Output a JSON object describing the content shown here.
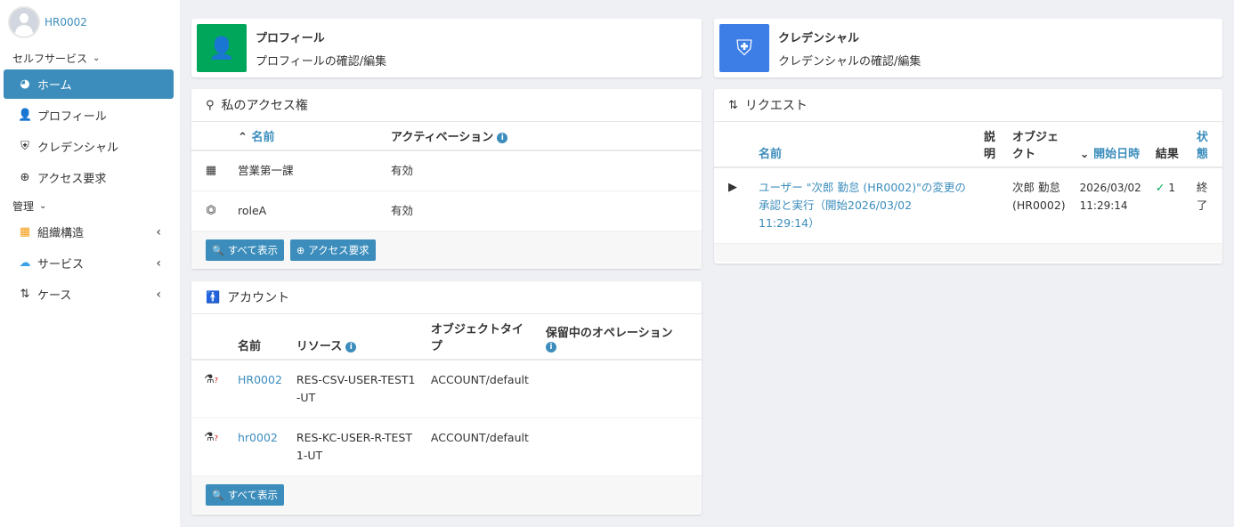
{
  "user": {
    "name": "HR0002"
  },
  "sidebar": {
    "self_service_header": "セルフサービス",
    "admin_header": "管理",
    "items": [
      {
        "label": "ホーム",
        "icon": "dashboard-icon"
      },
      {
        "label": "プロフィール",
        "icon": "user-icon"
      },
      {
        "label": "クレデンシャル",
        "icon": "shield-icon"
      },
      {
        "label": "アクセス要求",
        "icon": "plus-circle-icon"
      }
    ],
    "admin_items": [
      {
        "label": "組織構造",
        "icon": "building-icon"
      },
      {
        "label": "サービス",
        "icon": "cloud-icon"
      },
      {
        "label": "ケース",
        "icon": "sort-arrows-icon"
      }
    ]
  },
  "profile_box": {
    "title": "プロフィール",
    "subtitle": "プロフィールの確認/編集",
    "color": "#00a65a"
  },
  "credential_box": {
    "title": "クレデンシャル",
    "subtitle": "クレデンシャルの確認/編集",
    "color": "#3c7de6"
  },
  "access": {
    "title": "私のアクセス権",
    "columns": {
      "name": "名前",
      "activation": "アクティベーション"
    },
    "rows": [
      {
        "name": "営業第一課",
        "activation": "有効",
        "icon": "building-icon"
      },
      {
        "name": "roleA",
        "activation": "有効",
        "icon": "role-icon"
      }
    ],
    "show_all": "すべて表示",
    "request_access": "アクセス要求"
  },
  "accounts": {
    "title": "アカウント",
    "columns": {
      "name": "名前",
      "resource": "リソース",
      "object_type": "オブジェクトタイプ",
      "pending": "保留中のオペレーション"
    },
    "rows": [
      {
        "name": "HR0002",
        "resource": "RES-CSV-USER-TEST1-UT",
        "object_type": "ACCOUNT/default"
      },
      {
        "name": "hr0002",
        "resource": "RES-KC-USER-R-TEST1-UT",
        "object_type": "ACCOUNT/default"
      }
    ],
    "show_all": "すべて表示"
  },
  "requests": {
    "title": "リクエスト",
    "columns": {
      "name": "名前",
      "description": "説明",
      "object": "オブジェクト",
      "start": "開始日時",
      "result": "結果",
      "state": "状態"
    },
    "rows": [
      {
        "name": "ユーザー \"次郎 勤怠 (HR0002)\"の変更の承認と実行（開始2026/03/02 11:29:14）",
        "object": "次郎 勤怠 (HR0002)",
        "start": "2026/03/02 11:29:14",
        "result": "1",
        "state": "終了"
      }
    ]
  }
}
